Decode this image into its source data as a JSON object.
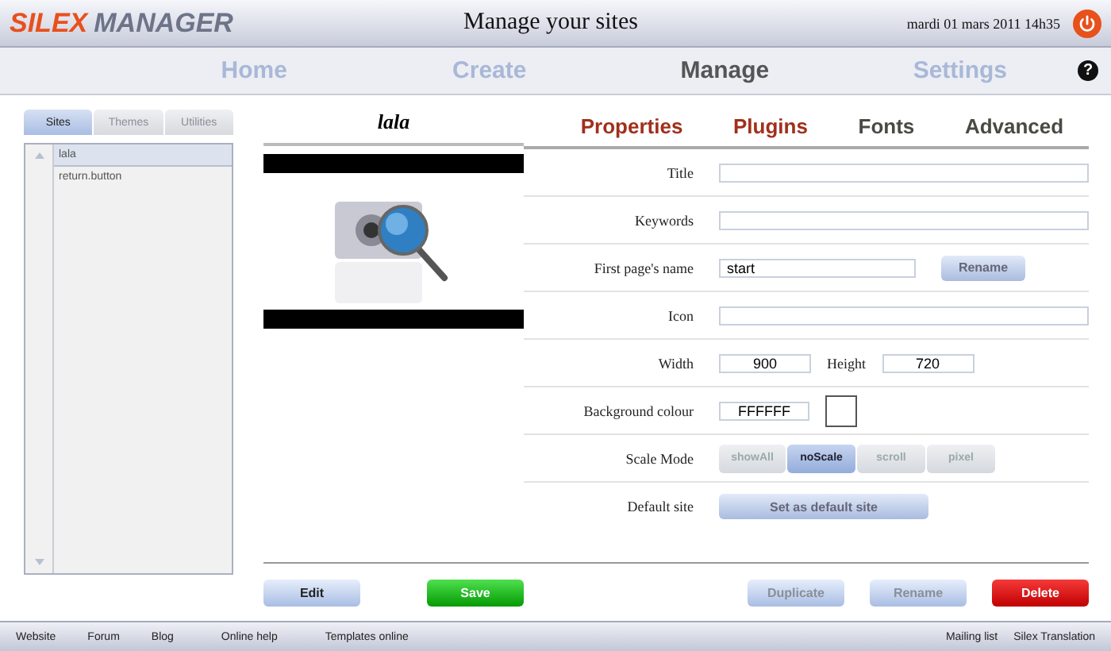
{
  "header": {
    "logo_first": "SILEX",
    "logo_second": "MANAGER",
    "title": "Manage your sites",
    "datetime": "mardi 01 mars 2011 14h35"
  },
  "nav": [
    {
      "label": "Home",
      "selected": false
    },
    {
      "label": "Create",
      "selected": false
    },
    {
      "label": "Manage",
      "selected": true
    },
    {
      "label": "Settings",
      "selected": false
    }
  ],
  "help": "?",
  "sidebar": {
    "tabs": [
      {
        "label": "Sites",
        "selected": true
      },
      {
        "label": "Themes",
        "selected": false
      },
      {
        "label": "Utilities",
        "selected": false
      }
    ],
    "items": [
      {
        "label": "lala",
        "selected": true
      },
      {
        "label": "return.button",
        "selected": false
      }
    ]
  },
  "site_name": "lala",
  "property_tabs": [
    {
      "label": "Properties",
      "color": "#a0301c"
    },
    {
      "label": "Plugins",
      "color": "#a0301c"
    },
    {
      "label": "Fonts",
      "color": "#4a4a44"
    },
    {
      "label": "Advanced",
      "color": "#4a4a44"
    }
  ],
  "fields": [
    {
      "kind": "text",
      "label": "Title"
    },
    {
      "kind": "text",
      "label": "Keywords"
    },
    {
      "kind": "text_button",
      "label": "First page's name",
      "value": "start",
      "button": "Rename"
    },
    {
      "kind": "text",
      "label": "Icon"
    },
    {
      "kind": "size",
      "label": "Width",
      "value": "900",
      "label2": "Height",
      "value2": "720"
    },
    {
      "kind": "color",
      "label": "Background colour",
      "value": "FFFFFF",
      "color": "#ffffff"
    },
    {
      "kind": "segmented",
      "label": "Scale Mode",
      "options": [
        {
          "label": "showAll",
          "selected": false
        },
        {
          "label": "noScale",
          "selected": true
        },
        {
          "label": "scroll",
          "selected": false
        },
        {
          "label": "pixel",
          "selected": false
        }
      ]
    },
    {
      "kind": "button",
      "label": "Default site",
      "button": "Set as default site"
    }
  ],
  "actions": [
    {
      "label": "Edit",
      "kind": "normal",
      "disabled": false
    },
    {
      "label": "Save",
      "kind": "success",
      "disabled": false
    },
    {
      "label": "Duplicate",
      "kind": "normal",
      "disabled": true
    },
    {
      "label": "Rename",
      "kind": "normal",
      "disabled": true
    },
    {
      "label": "Delete",
      "kind": "danger",
      "disabled": false
    }
  ],
  "footer": {
    "left": [
      "Website",
      "Forum",
      "Blog",
      "Online help",
      "Templates online"
    ],
    "right": [
      "Mailing list",
      "Silex Translation"
    ]
  }
}
